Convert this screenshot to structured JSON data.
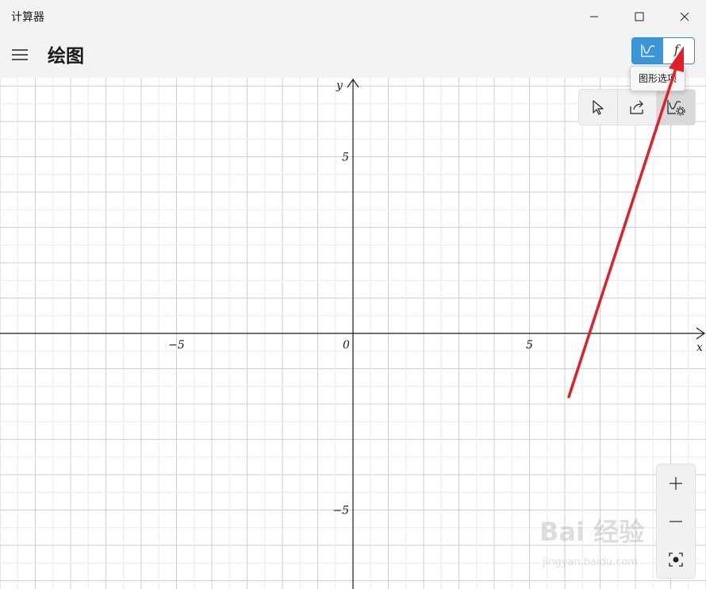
{
  "window": {
    "title": "计算器",
    "controls": [
      "minimize-icon",
      "maximize-icon",
      "close-icon"
    ]
  },
  "header": {
    "menu_icon": "hamburger-icon",
    "title": "绘图",
    "mode_toggle": {
      "graph_icon": "graph-icon",
      "function_label": "f",
      "function_sub": "x",
      "selected": "graph"
    },
    "tooltip": "图形选项"
  },
  "graph_tools": {
    "buttons": [
      "trace-cursor-icon",
      "share-icon",
      "graph-options-icon"
    ]
  },
  "zoom": {
    "buttons": [
      "zoom-in-icon",
      "zoom-out-icon",
      "reset-view-icon"
    ]
  },
  "axes": {
    "x_label": "x",
    "y_label": "y",
    "x_ticks": [
      {
        "value": -5,
        "label": "−5"
      },
      {
        "value": 5,
        "label": "5"
      }
    ],
    "y_ticks": [
      {
        "value": 5,
        "label": "5"
      },
      {
        "value": -5,
        "label": "−5"
      }
    ],
    "origin_label": "0",
    "x_range": [
      -10,
      10
    ],
    "y_range": [
      -10,
      10
    ],
    "grid": true,
    "colors": {
      "major": "#cfcfcf",
      "minor": "#ececec",
      "axis": "#1a1a1a"
    }
  },
  "annotation": {
    "type": "red-arrow",
    "color": "#e21e28",
    "points_to": "mode-toggle-function-button"
  },
  "watermark": {
    "main": "Bai 经验",
    "sub": "jingyan.baidu.com"
  },
  "colors": {
    "accent": "#3a96d8",
    "chrome_bg": "#f3f3f3"
  }
}
